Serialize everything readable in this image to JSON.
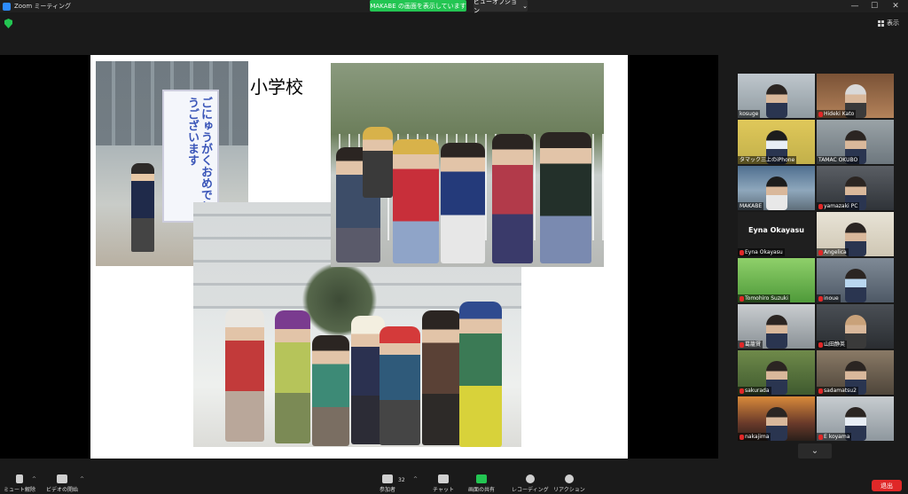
{
  "window": {
    "title": "Zoom ミーティング",
    "share_banner": "MAKABE の画面を表示しています",
    "view_options": "ビューオプション",
    "minimize": "—",
    "maximize": "☐",
    "close": "✕"
  },
  "topbar": {
    "show_label": "表示"
  },
  "slide": {
    "title": "小学校",
    "sign_text": "ごにゅうがくおめでとうございます"
  },
  "gallery": {
    "participants": [
      {
        "name": "kosuge",
        "muted": false
      },
      {
        "name": "Hideki Kato",
        "muted": true
      },
      {
        "name": "タマック三上のiPhone",
        "muted": false
      },
      {
        "name": "TAMAC OKUBO",
        "muted": false
      },
      {
        "name": "MAKABE",
        "muted": false
      },
      {
        "name": "yamazaki PC",
        "muted": true
      },
      {
        "name": "Eyna Okayasu",
        "muted": true
      },
      {
        "name": "Angelica",
        "muted": true
      },
      {
        "name": "Tomohiro Suzuki",
        "muted": true
      },
      {
        "name": "inoue",
        "muted": true
      },
      {
        "name": "葛籠賢",
        "muted": true
      },
      {
        "name": "山田静英",
        "muted": true
      },
      {
        "name": "sakurada",
        "muted": true
      },
      {
        "name": "sadamatsu2",
        "muted": true
      },
      {
        "name": "nakajima",
        "muted": true
      },
      {
        "name": "E koyama",
        "muted": true
      }
    ],
    "eyna_big_name": "Eyna Okayasu"
  },
  "toolbar": {
    "mute_label": "ミュート解除",
    "video_label": "ビデオの開始",
    "participants_label": "参加者",
    "participants_count": "32",
    "chat_label": "チャット",
    "share_label": "画面の共有",
    "record_label": "レコーディング",
    "reactions_label": "リアクション",
    "leave_label": "退出"
  }
}
